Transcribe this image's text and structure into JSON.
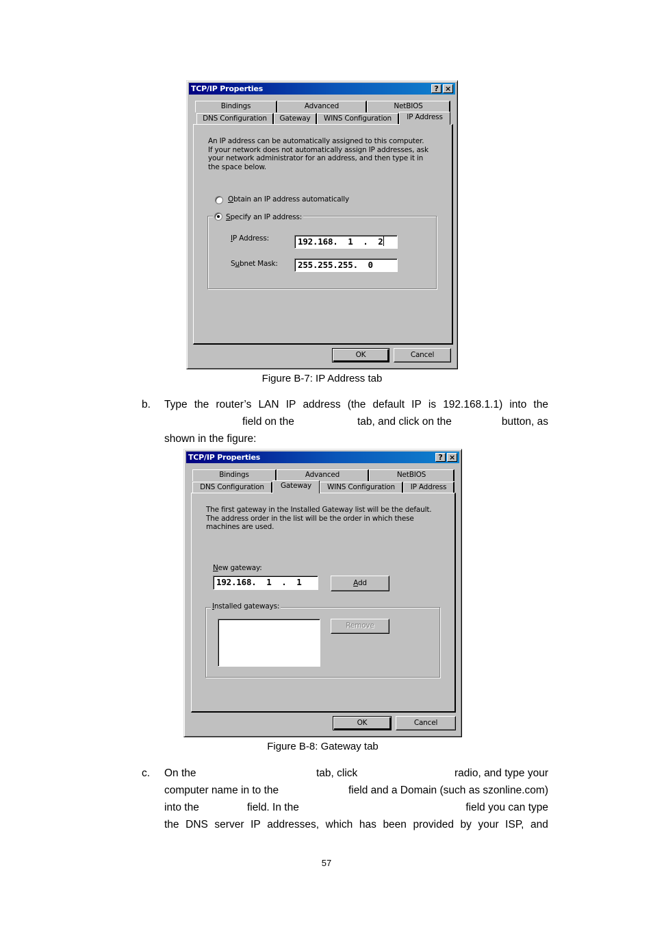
{
  "figure1": {
    "title": "TCP/IP Properties",
    "help_btn": "?",
    "close_btn": "×",
    "tabs_row1": [
      "Bindings",
      "Advanced",
      "NetBIOS"
    ],
    "tabs_row2": [
      "DNS Configuration",
      "Gateway",
      "WINS Configuration",
      "IP Address"
    ],
    "active_tab": "IP Address",
    "description": [
      "An IP address can be automatically assigned to this computer.",
      "If your network does not automatically assign IP addresses, ask",
      "your network administrator for an address, and then type it in",
      "the space below."
    ],
    "radio_obtain": {
      "accel": "O",
      "rest": "btain an IP address automatically",
      "selected": false
    },
    "radio_specify": {
      "accel": "S",
      "rest": "pecify an IP address:",
      "selected": true
    },
    "ip_label": {
      "accel": "I",
      "rest": "P Address:"
    },
    "ip_value": "192.168.  1  .  2",
    "mask_label": {
      "pre": "S",
      "accel": "u",
      "rest": "bnet Mask:"
    },
    "mask_value": "255.255.255.  0",
    "ok": "OK",
    "cancel": "Cancel",
    "caption": "Figure B-7: IP Address tab"
  },
  "step_b": {
    "marker": "b.",
    "lines": [
      [
        "Type",
        "the",
        "router’s",
        "LAN",
        "IP",
        "address",
        "(the",
        "default",
        "IP",
        "is",
        "192.168.1.1)",
        "into",
        "the"
      ],
      [
        "",
        "field on the",
        "tab, and click on the",
        "button, as"
      ],
      [
        "shown in the figure:"
      ]
    ]
  },
  "figure2": {
    "title": "TCP/IP Properties",
    "help_btn": "?",
    "close_btn": "×",
    "tabs_row1": [
      "Bindings",
      "Advanced",
      "NetBIOS"
    ],
    "tabs_row2": [
      "DNS Configuration",
      "Gateway",
      "WINS Configuration",
      "IP Address"
    ],
    "active_tab": "Gateway",
    "description": [
      "The first gateway in the Installed Gateway list will be the default.",
      "The address order in the list will be the order in which these",
      "machines are used."
    ],
    "new_gateway_label": {
      "accel": "N",
      "rest": "ew gateway:"
    },
    "new_gateway_value": "192.168.  1  .  1",
    "add_btn": {
      "accel": "A",
      "rest": "dd"
    },
    "installed_label": {
      "accel": "I",
      "rest": "nstalled gateways:"
    },
    "installed_items": [],
    "remove_btn": {
      "accel": "R",
      "rest": "emove",
      "disabled": true
    },
    "ok": "OK",
    "cancel": "Cancel",
    "caption": "Figure B-8: Gateway tab"
  },
  "step_c": {
    "marker": "c.",
    "lines": [
      [
        "On the",
        "tab, click",
        "radio, and type your"
      ],
      [
        "computer name in to the",
        "field and a Domain (such as szonline.com)"
      ],
      [
        "into the",
        "field. In the",
        "field you can type"
      ],
      [
        "the",
        "DNS",
        "server",
        "IP",
        "addresses,",
        "which",
        "has",
        "been",
        "provided",
        "by",
        "your",
        "ISP,",
        "and"
      ]
    ]
  },
  "page_number": "57"
}
